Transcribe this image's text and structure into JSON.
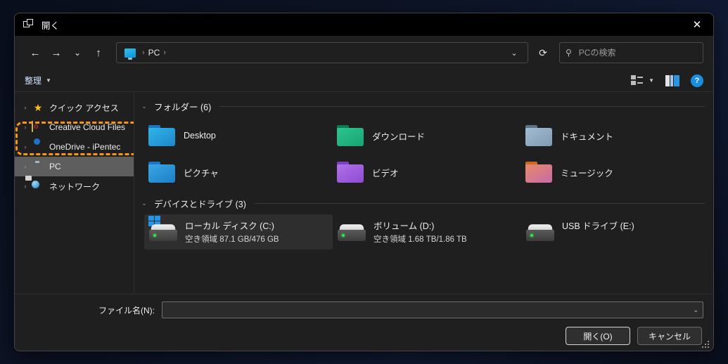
{
  "window": {
    "title": "開く",
    "icon": "window-icon",
    "close_label": "✕"
  },
  "nav": {
    "back": "←",
    "forward": "→",
    "recent": "⌄",
    "up": "↑",
    "breadcrumb": {
      "icon": "pc-icon",
      "sep1": "›",
      "item": "PC",
      "sep2": "›"
    },
    "dropdown": "⌄",
    "refresh": "⟳",
    "search": {
      "icon": "search-icon",
      "placeholder": "PCの検索",
      "value": ""
    }
  },
  "commandbar": {
    "organize_label": "整理",
    "organize_caret": "▼",
    "view_caret": "▼",
    "help_label": "?"
  },
  "sidebar": {
    "items": [
      {
        "label": "クイック アクセス",
        "icon": "star-icon",
        "chevron": "›",
        "selected": false,
        "highlighted": false
      },
      {
        "label": "Creative Cloud Files",
        "icon": "creative-cloud-icon",
        "chevron": "›",
        "selected": false,
        "highlighted": true
      },
      {
        "label": "OneDrive - iPentec",
        "icon": "cloud-icon",
        "chevron": "›",
        "selected": false,
        "highlighted": false
      },
      {
        "label": "PC",
        "icon": "pc-icon",
        "chevron": "›",
        "selected": true,
        "highlighted": false
      },
      {
        "label": "ネットワーク",
        "icon": "network-icon",
        "chevron": "›",
        "selected": false,
        "highlighted": false
      }
    ]
  },
  "content": {
    "folders_section": {
      "chevron": "⌄",
      "title": "フォルダー (6)",
      "items": [
        {
          "name": "Desktop",
          "icon": "folder-desktop-icon",
          "color_tab": "#1b74c4",
          "color_body": "#2ab3e8"
        },
        {
          "name": "ダウンロード",
          "icon": "folder-downloads-icon",
          "color_tab": "#0f8f63",
          "color_body": "#2ec58e"
        },
        {
          "name": "ドキュメント",
          "icon": "folder-documents-icon",
          "color_tab": "#5d7384",
          "color_body": "#8aa6bd"
        },
        {
          "name": "ピクチャ",
          "icon": "folder-pictures-icon",
          "color_tab": "#1b74c4",
          "color_body": "#2f9fe0"
        },
        {
          "name": "ビデオ",
          "icon": "folder-videos-icon",
          "color_tab": "#7b3fc4",
          "color_body": "#a濃"
        },
        {
          "name": "ミュージック",
          "icon": "folder-music-icon",
          "color_tab": "#c96a1e",
          "color_body": "#e08a6a"
        }
      ]
    },
    "drives_section": {
      "chevron": "⌄",
      "title": "デバイスとドライブ (3)",
      "items": [
        {
          "name": "ローカル ディスク (C:)",
          "free_text": "空き領域 87.1 GB/476 GB",
          "used_percent": 82,
          "has_bar": true,
          "selected": true,
          "windows_logo": true
        },
        {
          "name": "ボリューム (D:)",
          "free_text": "空き領域 1.68 TB/1.86 TB",
          "used_percent": 10,
          "has_bar": true,
          "selected": false,
          "windows_logo": false
        },
        {
          "name": "USB ドライブ (E:)",
          "free_text": "",
          "used_percent": 0,
          "has_bar": false,
          "selected": false,
          "windows_logo": false
        }
      ]
    }
  },
  "footer": {
    "filename_label": "ファイル名(N):",
    "filename_value": "",
    "filename_placeholder": "",
    "filename_caret": "⌄",
    "open_button": "開く(O)",
    "cancel_button": "キャンセル"
  },
  "colors": {
    "accent": "#1a8fe0",
    "highlight_annotation": "#f7941e",
    "selection": "#5e5e5e",
    "window_bg": "#1f1f1f",
    "titlebar_bg": "#000000"
  }
}
